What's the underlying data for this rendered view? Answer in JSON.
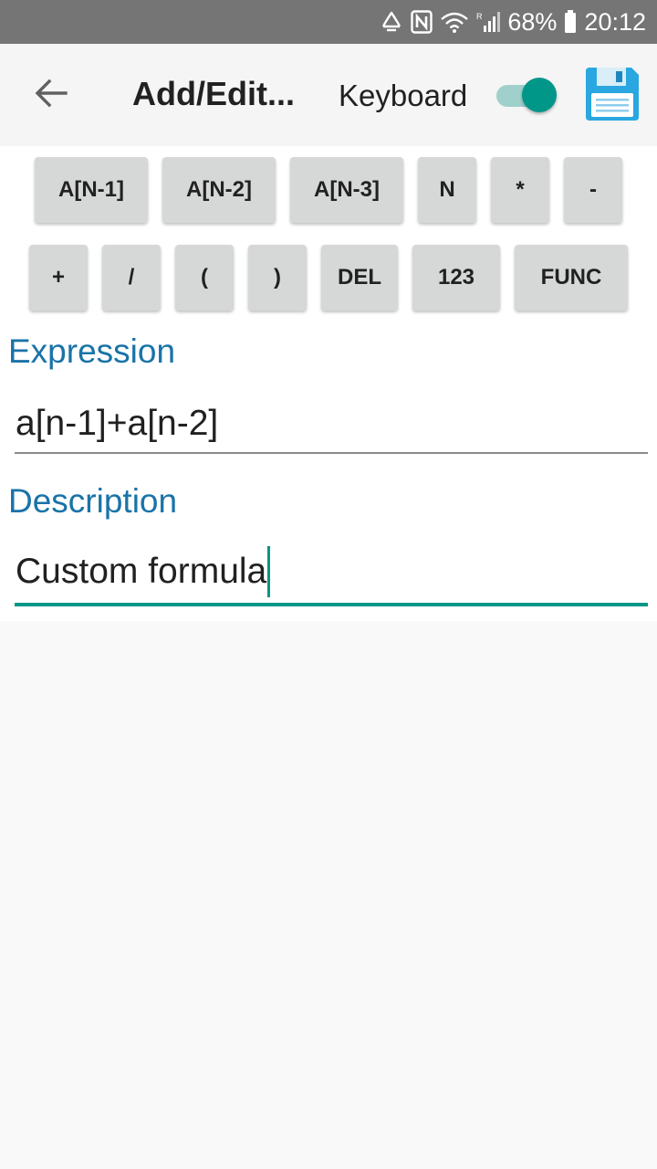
{
  "status_bar": {
    "battery": "68%",
    "time": "20:12",
    "icons": [
      "recycle-icon",
      "nfc-icon",
      "wifi-icon",
      "signal-icon",
      "battery-icon"
    ]
  },
  "app_bar": {
    "title": "Add/Edit...",
    "keyboard_label": "Keyboard",
    "keyboard_enabled": true,
    "icons": [
      "back-arrow-icon",
      "save-floppy-icon"
    ]
  },
  "keypad": {
    "row1": [
      "A[N-1]",
      "A[N-2]",
      "A[N-3]",
      "N",
      "*",
      "-"
    ],
    "row2": [
      "+",
      "/",
      "(",
      ")",
      "DEL",
      "123",
      "FUNC"
    ]
  },
  "expression": {
    "label": "Expression",
    "value": "a[n-1]+a[n-2]"
  },
  "description": {
    "label": "Description",
    "value": "Custom formula"
  },
  "colors": {
    "accent": "#009688",
    "label": "#1a73a8",
    "status_bar": "#757575"
  }
}
